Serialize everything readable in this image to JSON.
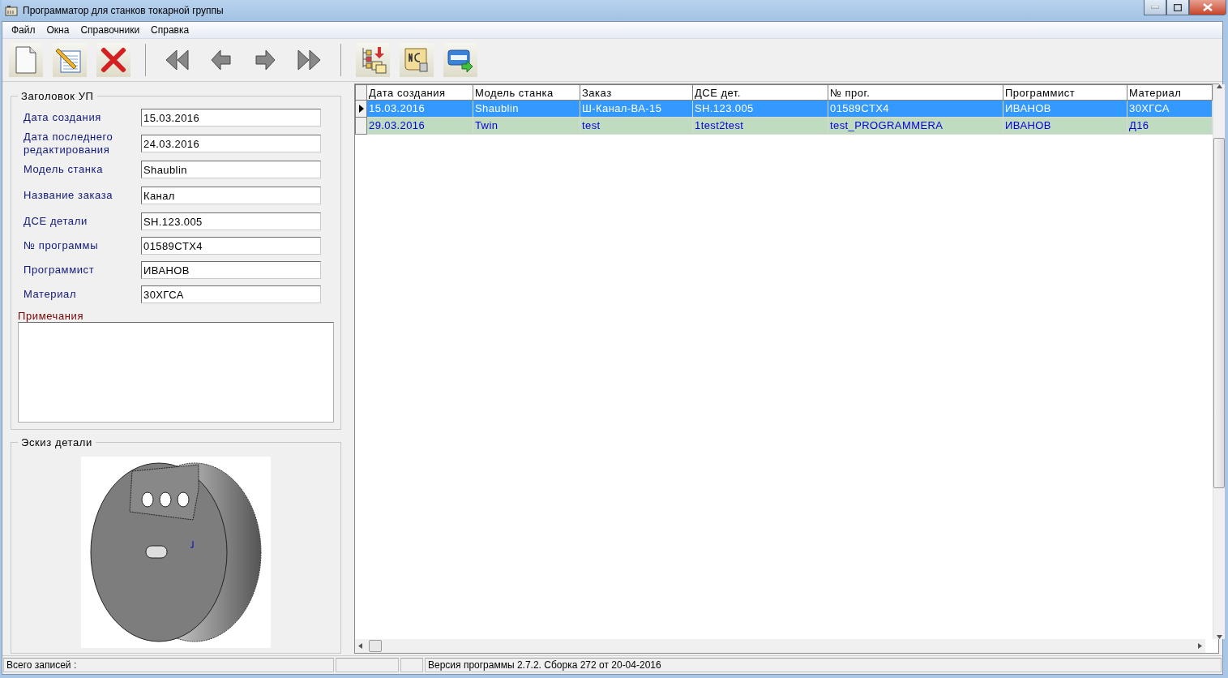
{
  "window": {
    "title": "Программатор для станков токарной группы"
  },
  "menu": [
    "Файл",
    "Окна",
    "Справочники",
    "Справка"
  ],
  "toolbar": [
    {
      "kind": "new"
    },
    {
      "kind": "edit"
    },
    {
      "kind": "delete"
    },
    {
      "kind": "separator"
    },
    {
      "kind": "first"
    },
    {
      "kind": "prev"
    },
    {
      "kind": "next"
    },
    {
      "kind": "last"
    },
    {
      "kind": "separator"
    },
    {
      "kind": "tree"
    },
    {
      "kind": "nc"
    },
    {
      "kind": "html"
    }
  ],
  "header_group": {
    "title": "Заголовок УП",
    "fields": [
      {
        "label": "Дата создания",
        "value": "15.03.2016"
      },
      {
        "label": "Дата последнего редактирования",
        "value": "24.03.2016"
      },
      {
        "label": "Модель станка",
        "value": "Shaublin"
      },
      {
        "label": "Название заказа",
        "value": "Канал"
      },
      {
        "label": "ДСЕ детали",
        "value": "SH.123.005"
      },
      {
        "label": "№ программы",
        "value": "01589CTX4"
      },
      {
        "label": "Программист",
        "value": "ИВАНОВ"
      },
      {
        "label": "Материал",
        "value": "30ХГСА"
      }
    ],
    "notes_label": "Примечания"
  },
  "sketch_group": {
    "title": "Эскиз детали"
  },
  "table": {
    "columns": [
      "Дата создания",
      "Модель станка",
      "Заказ",
      "ДСЕ дет.",
      "№ прог.",
      "Программист",
      "Материал"
    ],
    "rows": [
      {
        "selected": true,
        "cells": [
          "15.03.2016",
          "Shaublin",
          "Ш-Канал-ВА-15",
          "SH.123.005",
          "01589CTX4",
          "ИВАНОВ",
          "30ХГСА"
        ]
      },
      {
        "selected": false,
        "cells": [
          "29.03.2016",
          "Twin",
          "test",
          "1test2test",
          "test_PROGRAMMERA",
          "ИВАНОВ",
          "Д16"
        ]
      }
    ]
  },
  "status_bar": {
    "records": "Всего записей :",
    "version": "Версия программы 2.7.2. Сборка 272 от 20-04-2016"
  }
}
